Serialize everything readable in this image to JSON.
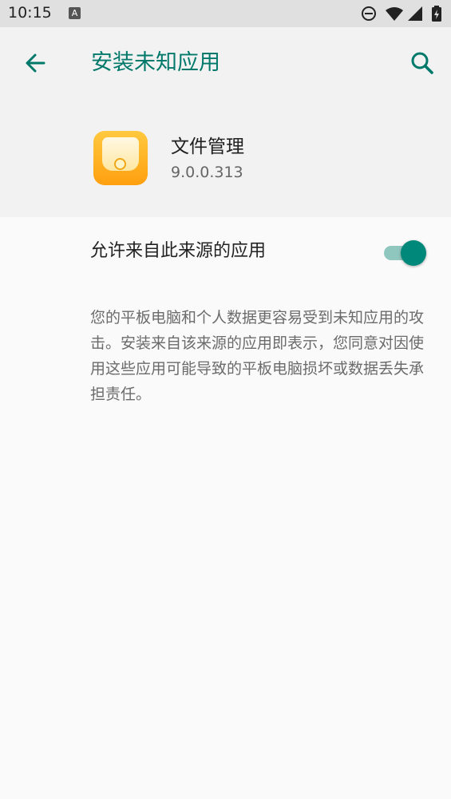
{
  "status_bar": {
    "time": "10:15",
    "app_badge": "A",
    "icons": [
      "do-not-disturb-icon",
      "wifi-icon",
      "signal-icon",
      "battery-charging-icon"
    ]
  },
  "app_bar": {
    "title": "安装未知应用",
    "back_icon": "arrow-back-icon",
    "search_icon": "search-icon"
  },
  "app": {
    "name": "文件管理",
    "version": "9.0.0.313",
    "icon": "folder-icon"
  },
  "setting": {
    "label": "允许来自此来源的应用",
    "toggle_on": true
  },
  "description": "您的平板电脑和个人数据更容易受到未知应用的攻击。安装来自该来源的应用即表示，您同意对因使用这些应用可能导致的平板电脑损坏或数据丢失承担责任。",
  "colors": {
    "accent": "#00796b",
    "toggle_thumb": "#00897b",
    "toggle_track": "#8fc7bf",
    "background": "#fafafa",
    "header_background": "#f2f2f2",
    "status_bar": "#e0e0e0"
  }
}
